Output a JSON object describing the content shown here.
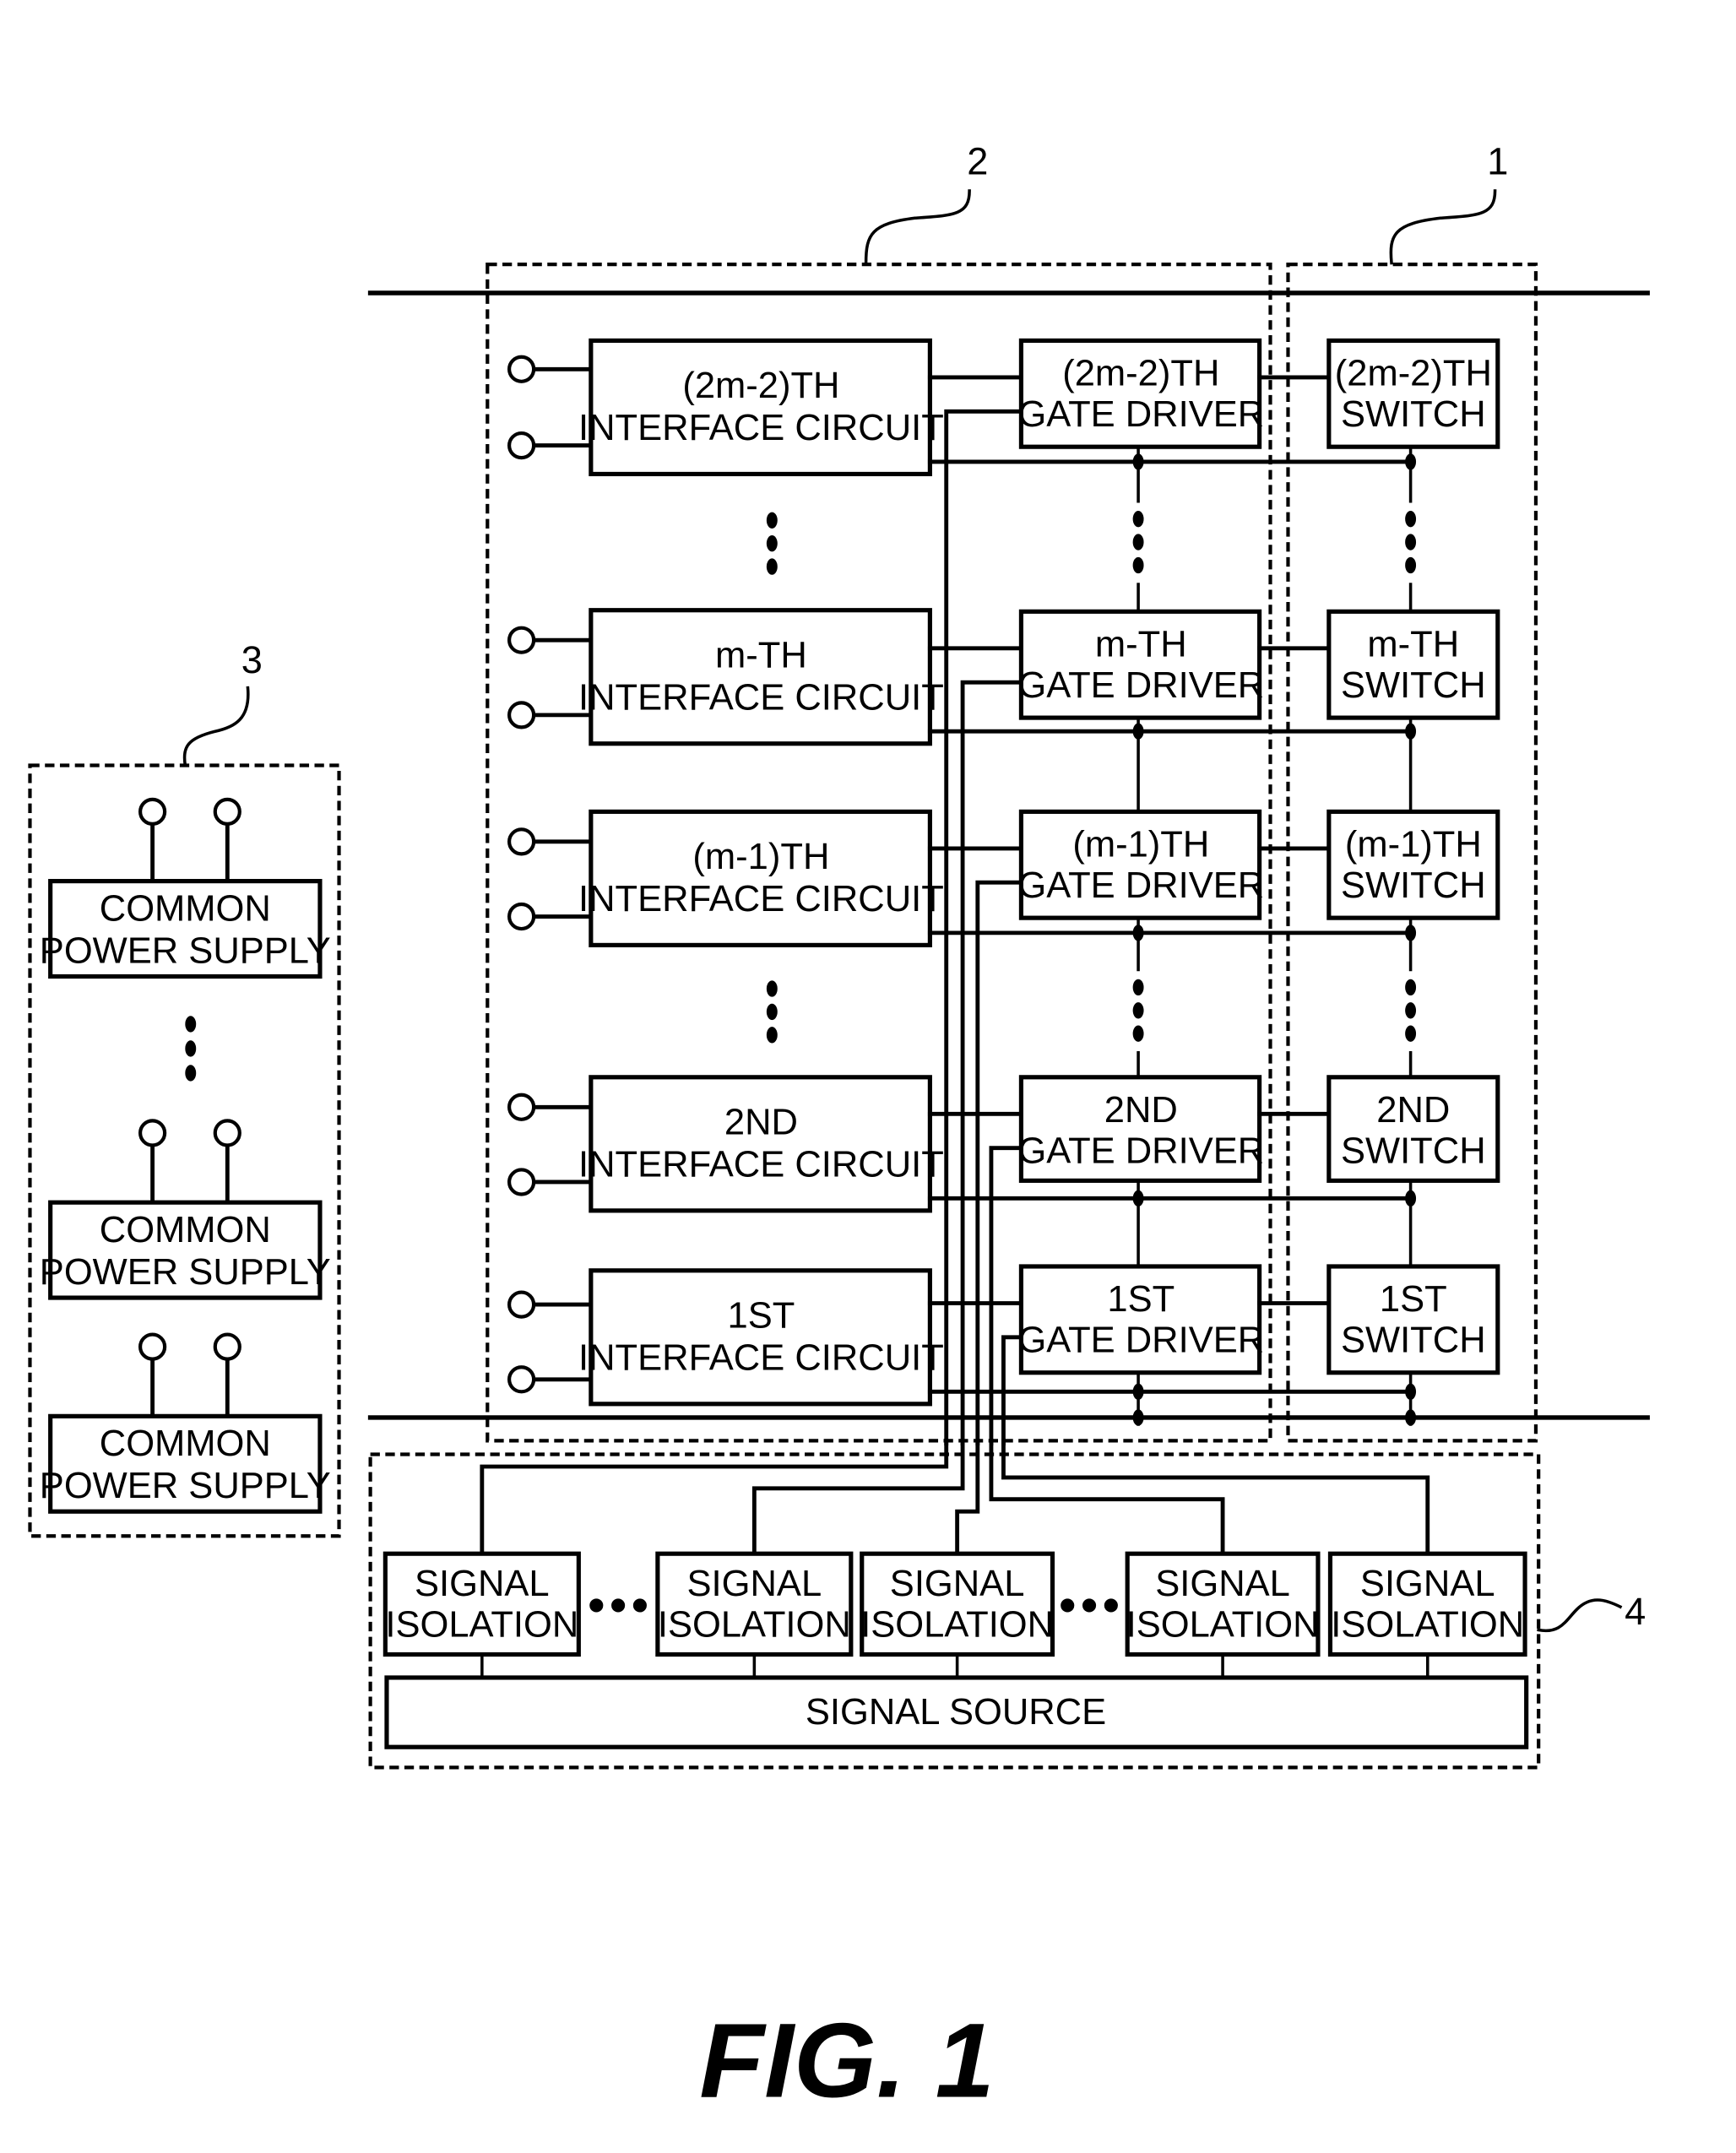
{
  "figure": {
    "caption": "FIG. 1",
    "colors": {
      "ink": "#000000",
      "background": "#ffffff"
    }
  },
  "reference_numerals": {
    "switch_group": "1",
    "driver_group": "2",
    "power_group": "3",
    "signal_group": "4"
  },
  "rows": [
    {
      "ordinal": "(2m-2)TH",
      "interface": [
        "(2m-2)TH",
        "INTERFACE CIRCUIT"
      ],
      "gate_driver": [
        "(2m-2)TH",
        "GATE DRIVER"
      ],
      "switch": [
        "(2m-2)TH",
        "SWITCH"
      ]
    },
    {
      "ordinal": "m-TH",
      "interface": [
        "m-TH",
        "INTERFACE CIRCUIT"
      ],
      "gate_driver": [
        "m-TH",
        "GATE DRIVER"
      ],
      "switch": [
        "m-TH",
        "SWITCH"
      ]
    },
    {
      "ordinal": "(m-1)TH",
      "interface": [
        "(m-1)TH",
        "INTERFACE CIRCUIT"
      ],
      "gate_driver": [
        "(m-1)TH",
        "GATE DRIVER"
      ],
      "switch": [
        "(m-1)TH",
        "SWITCH"
      ]
    },
    {
      "ordinal": "2ND",
      "interface": [
        "2ND",
        "INTERFACE CIRCUIT"
      ],
      "gate_driver": [
        "2ND",
        "GATE DRIVER"
      ],
      "switch": [
        "2ND",
        "SWITCH"
      ]
    },
    {
      "ordinal": "1ST",
      "interface": [
        "1ST",
        "INTERFACE CIRCUIT"
      ],
      "gate_driver": [
        "1ST",
        "GATE DRIVER"
      ],
      "switch": [
        "1ST",
        "SWITCH"
      ]
    }
  ],
  "power_supplies": [
    {
      "label": [
        "COMMON",
        "POWER SUPPLY"
      ]
    },
    {
      "label": [
        "COMMON",
        "POWER SUPPLY"
      ]
    },
    {
      "label": [
        "COMMON",
        "POWER SUPPLY"
      ]
    }
  ],
  "signal_isolations": [
    {
      "label": [
        "SIGNAL",
        "ISOLATION"
      ]
    },
    {
      "label": [
        "SIGNAL",
        "ISOLATION"
      ]
    },
    {
      "label": [
        "SIGNAL",
        "ISOLATION"
      ]
    },
    {
      "label": [
        "SIGNAL",
        "ISOLATION"
      ]
    },
    {
      "label": [
        "SIGNAL",
        "ISOLATION"
      ]
    }
  ],
  "signal_source": {
    "label": "SIGNAL SOURCE"
  },
  "ellipsis": "⋮"
}
